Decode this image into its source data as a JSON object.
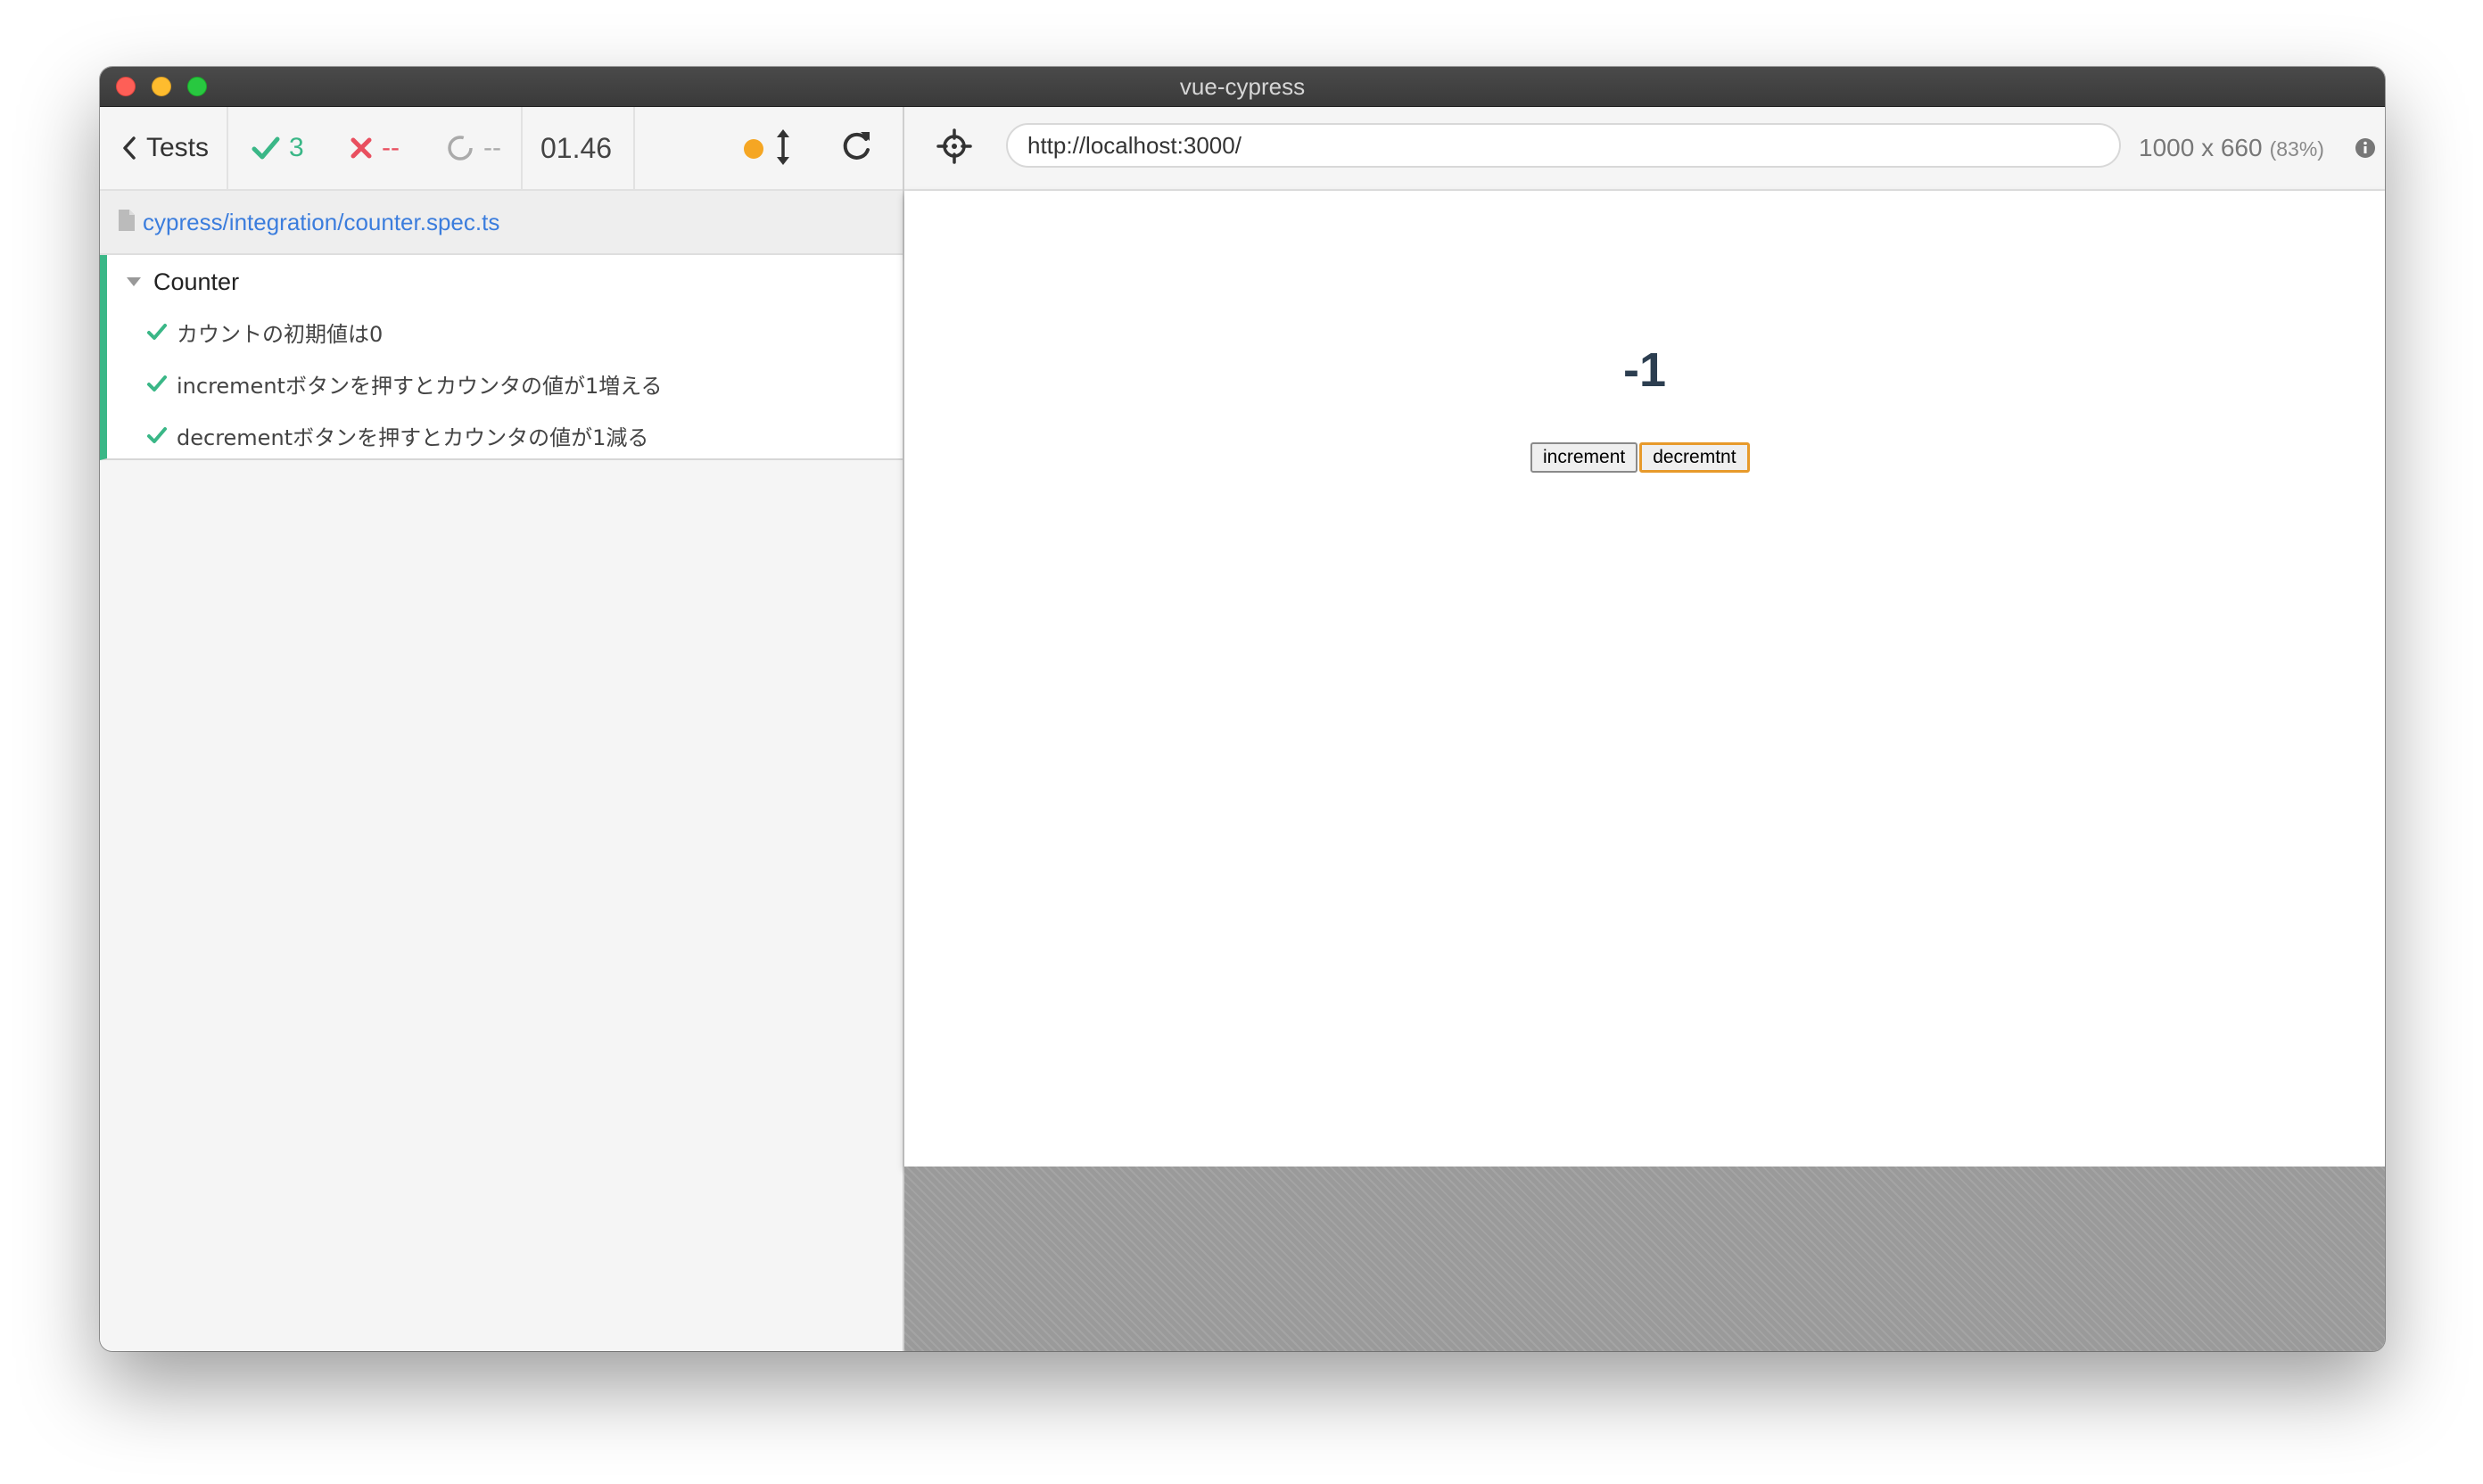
{
  "window": {
    "title": "vue-cypress"
  },
  "reporter": {
    "tests_label": "Tests",
    "passed_count": "3",
    "failed_count": "--",
    "pending_count": "--",
    "duration": "01.46",
    "spec_path": "cypress/integration/counter.spec.ts",
    "suite": {
      "title": "Counter",
      "tests": [
        {
          "title": "カウントの初期値は0",
          "state": "passed"
        },
        {
          "title": "incrementボタンを押すとカウンタの値が1増える",
          "state": "passed"
        },
        {
          "title": "decrementボタンを押すとカウンタの値が1減る",
          "state": "passed"
        }
      ]
    }
  },
  "aut": {
    "url": "http://localhost:3000/",
    "viewport_size": "1000 x 660",
    "viewport_scale": "(83%)",
    "app": {
      "count": "-1",
      "increment_label": "increment",
      "decrement_label": "decremtnt"
    }
  },
  "colors": {
    "passed": "#3ab787",
    "failed": "#e94f5f",
    "link": "#3b7ddd",
    "running_dot": "#f5a623",
    "focus_outline": "#e79a2b"
  },
  "icons": [
    "chevron-left-icon",
    "check-icon",
    "x-icon",
    "pending-circle-icon",
    "status-dot-icon",
    "auto-scroll-icon",
    "reload-icon",
    "file-icon",
    "caret-down-icon",
    "selector-playground-icon",
    "info-icon"
  ]
}
